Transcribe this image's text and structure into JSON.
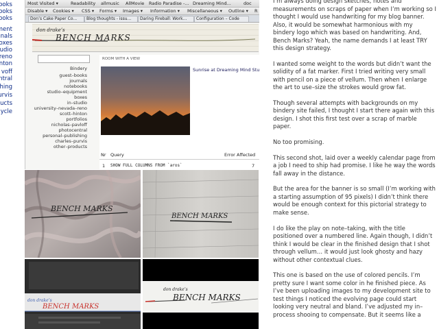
{
  "leftnav": [
    "ooks",
    "ooks",
    "ooks",
    "ment",
    "nals",
    "oxes",
    "udio",
    "reno",
    "nton",
    "voff",
    "ntral",
    "hing",
    "urvis",
    "ucts",
    "ycle"
  ],
  "browser": {
    "toolbar1": [
      "Most Visited ▾",
      "Readability",
      "allmusic",
      "AllMovie",
      "Radio Paradise -...",
      "Dreaming Mind...",
      "doc"
    ],
    "toolbar2": [
      "Disable ▾",
      "Cookies ▾",
      "CSS ▾",
      "Forms ▾",
      "Images ▾",
      "Information ▾",
      "Miscellaneous ▾",
      "Outline ▾",
      "R"
    ],
    "tabs": [
      "Don’s Cake Paper Co...",
      "Blog thoughts - issu...",
      "Daring Fireball: Work...",
      "Configuration – Code"
    ],
    "banner_small": "don drake’s",
    "banner_big": "BENCH MARKS",
    "sidebar": [
      "Bindery",
      "guest–books",
      "journals",
      "notebooks",
      "studio–equipment",
      "boxes",
      "in–studio",
      "university–nevada–reno",
      "scott–hinton",
      "portfolios",
      "nicholas–pavloff",
      "photocentral",
      "personal–publishing",
      "charles–purvis",
      "other–products"
    ],
    "content_header": "Room with a view",
    "photo_title": "Sunrise at Dreaming Mind Studio",
    "sql_headers": [
      "Nr",
      "Query",
      "Error",
      "Affected"
    ],
    "sql_row": [
      "1",
      "SHOW FULL COLUMNS FROM `aros`",
      "7"
    ]
  },
  "collage": {
    "banner_text": "BENCH MARKS",
    "banner_small": "don drake’s"
  },
  "article": {
    "paragraphs": [
      "I’m always doing design sketches, notes and measurements on scraps of paper when I’m working so I thought I would use handwriting for my blog banner. Also, it would be somewhat harmonious with my bindery logo which was based on handwriting. And, Bench Marks? Yeah, the name demands I at least TRY this design strategy.",
      "I wanted some weight to the words but didn’t want the solidity of a fat marker. First I tried writing very small with pencil on a piece of vellum. Then when I enlarge the art to use–size the strokes would grow fat.",
      "Though several attempts with backgrounds on my bindery site failed, I thought I start there again with this design. I shot this first test over a scrap of marble paper.",
      "No too promising.",
      "This second shot, laid over a weekly calendar page from a job I need to ship had promise. I like he way the words fall away in the distance.",
      "But the area for the banner is so small (I’m working with a starting assumption of 95 pixels) I didn’t think there would be enough context for this pictorial strategy to make sense.",
      "I do like the play on note–taking, with the title positioned over a numbered line. Again though, I didn’t think I would be clear in the finished design that I shot through vellum… it would just look ghosty and hazy without other contextual clues.",
      "This one is based on the use of colored pencils. I’m pretty sure I want some color in he finished piece. As I’ve been uploading images to my development site to test things I noticed the evolving page could start looking very neutral and bland. I’ve adjusted my in–process shooing to compensate. But it seems like a"
    ]
  },
  "colors": {
    "link": "#0b2a86",
    "text": "#333333",
    "red": "#cc2a2a"
  }
}
